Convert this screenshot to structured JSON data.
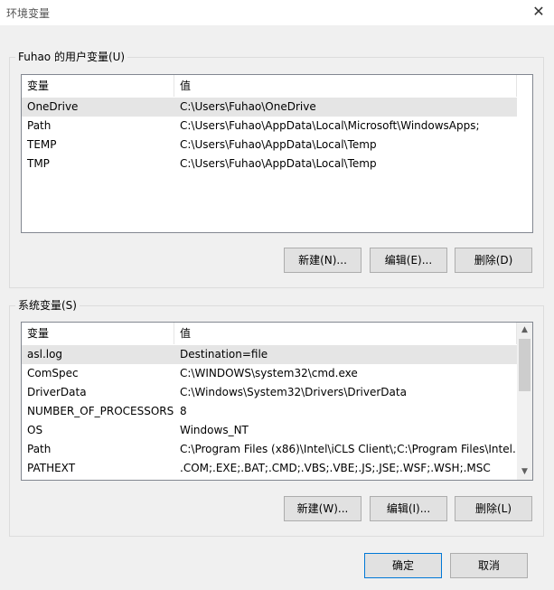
{
  "window": {
    "title": "环境变量",
    "close_glyph": "✕"
  },
  "user_vars": {
    "group_label": "Fuhao 的用户变量(U)",
    "columns": [
      "变量",
      "值"
    ],
    "rows": [
      {
        "name": "OneDrive",
        "value": "C:\\Users\\Fuhao\\OneDrive"
      },
      {
        "name": "Path",
        "value": "C:\\Users\\Fuhao\\AppData\\Local\\Microsoft\\WindowsApps;"
      },
      {
        "name": "TEMP",
        "value": "C:\\Users\\Fuhao\\AppData\\Local\\Temp"
      },
      {
        "name": "TMP",
        "value": "C:\\Users\\Fuhao\\AppData\\Local\\Temp"
      }
    ],
    "selected_row": 0,
    "buttons": {
      "new": "新建(N)...",
      "edit": "编辑(E)...",
      "delete": "删除(D)"
    }
  },
  "system_vars": {
    "group_label": "系统变量(S)",
    "columns": [
      "变量",
      "值"
    ],
    "rows": [
      {
        "name": "asl.log",
        "value": "Destination=file"
      },
      {
        "name": "ComSpec",
        "value": "C:\\WINDOWS\\system32\\cmd.exe"
      },
      {
        "name": "DriverData",
        "value": "C:\\Windows\\System32\\Drivers\\DriverData"
      },
      {
        "name": "NUMBER_OF_PROCESSORS",
        "value": "8"
      },
      {
        "name": "OS",
        "value": "Windows_NT"
      },
      {
        "name": "Path",
        "value": "C:\\Program Files (x86)\\Intel\\iCLS Client\\;C:\\Program Files\\Intel..."
      },
      {
        "name": "PATHEXT",
        "value": ".COM;.EXE;.BAT;.CMD;.VBS;.VBE;.JS;.JSE;.WSF;.WSH;.MSC"
      }
    ],
    "selected_row": 0,
    "scroll_up_glyph": "▲",
    "scroll_down_glyph": "▼",
    "buttons": {
      "new": "新建(W)...",
      "edit": "编辑(I)...",
      "delete": "删除(L)"
    }
  },
  "dialog_buttons": {
    "ok": "确定",
    "cancel": "取消"
  }
}
